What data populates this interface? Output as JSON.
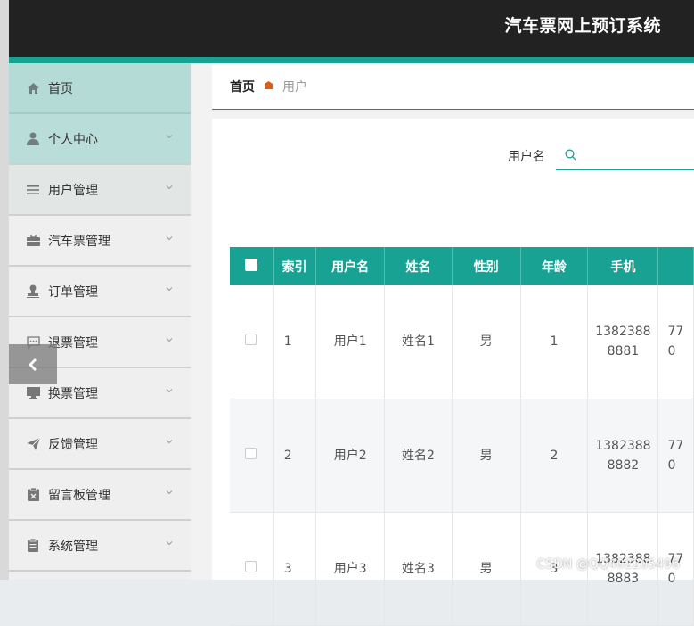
{
  "header": {
    "title": "汽车票网上预订系统"
  },
  "sidebar": {
    "items": [
      {
        "label": "首页",
        "icon": "home-icon"
      },
      {
        "label": "个人中心",
        "icon": "user-icon"
      },
      {
        "label": "用户管理",
        "icon": "list-icon"
      },
      {
        "label": "汽车票管理",
        "icon": "briefcase-icon"
      },
      {
        "label": "订单管理",
        "icon": "stamp-icon"
      },
      {
        "label": "退票管理",
        "icon": "chat-icon"
      },
      {
        "label": "换票管理",
        "icon": "monitor-icon"
      },
      {
        "label": "反馈管理",
        "icon": "send-icon"
      },
      {
        "label": "留言板管理",
        "icon": "clipboard-icon"
      },
      {
        "label": "系统管理",
        "icon": "document-icon"
      }
    ]
  },
  "breadcrumb": {
    "home": "首页",
    "current": "用户"
  },
  "search": {
    "label": "用户名",
    "value": ""
  },
  "table": {
    "headers": [
      "",
      "索引",
      "用户名",
      "姓名",
      "性别",
      "年龄",
      "手机",
      ""
    ],
    "rows": [
      {
        "index": "1",
        "username": "用户1",
        "name": "姓名1",
        "gender": "男",
        "age": "1",
        "phone_a": "1382388",
        "phone_b": "8881",
        "extra_a": "77",
        "extra_b": "0"
      },
      {
        "index": "2",
        "username": "用户2",
        "name": "姓名2",
        "gender": "男",
        "age": "2",
        "phone_a": "1382388",
        "phone_b": "8882",
        "extra_a": "77",
        "extra_b": "0"
      },
      {
        "index": "3",
        "username": "用户3",
        "name": "姓名3",
        "gender": "男",
        "age": "3",
        "phone_a": "1382388",
        "phone_b": "8883",
        "extra_a": "77",
        "extra_b": "0"
      }
    ]
  },
  "watermark": "CSDN @QQ402205496",
  "colors": {
    "accent": "#17a294",
    "header_bg": "#222222",
    "active_menu": "#b5dbd6"
  }
}
